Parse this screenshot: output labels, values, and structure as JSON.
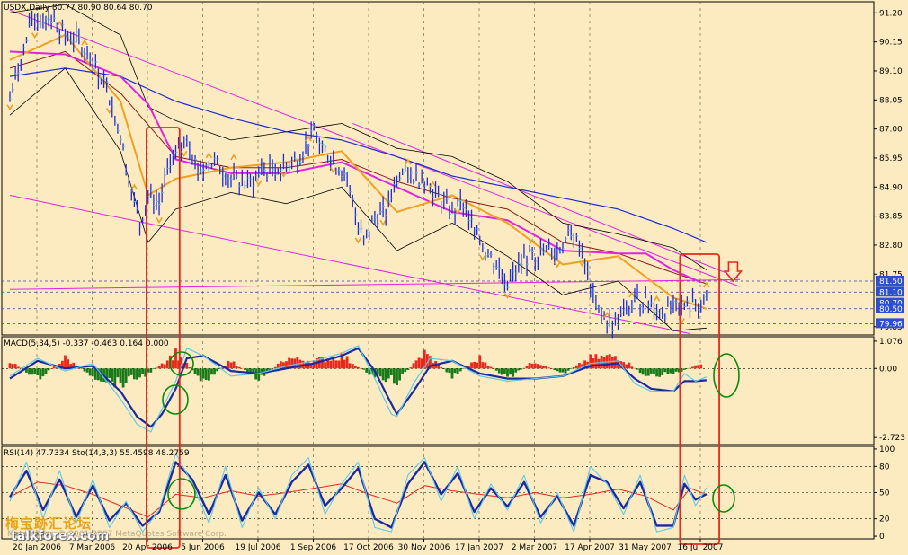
{
  "header": {
    "main": "USDX,Daily  80.77 80.90 80.64 80.70",
    "macd": "MACD(5,34,5) -0.337 -0.463 0.164 0.000",
    "rsi": "RSI(14) 47.7334  Sto(14,3,3) 55.4598 48.2759"
  },
  "watermark": {
    "site": "talkforex.com",
    "footer": "MetaTrader, © 2001-2007 MetaQuotes Software Corp.",
    "cn": "梅宝跡汇论坛"
  },
  "colors": {
    "background": "#FCEBC1",
    "axis": "#000000",
    "grid": "#7a6a4a",
    "rect_red": "#E8281C",
    "circle_green": "#0A8A0A",
    "price_line": "#1D2BD6",
    "macd_pos": "#E8281C",
    "macd_neg": "#1A7A1A",
    "ma_magenta": "#E024E0",
    "ma_orange": "#F0A020",
    "fractal": "#E8A12A"
  },
  "chart_data": [
    {
      "type": "line",
      "panel": "price",
      "symbol": "USDX",
      "timeframe": "Daily",
      "ohlc_last": {
        "open": 80.77,
        "high": 80.9,
        "low": 80.64,
        "close": 80.7
      },
      "y_ticks": [
        "91.20",
        "90.15",
        "89.10",
        "88.05",
        "87.00",
        "85.95",
        "84.90",
        "83.85",
        "82.80",
        "81.75",
        "79.85"
      ],
      "ylim": [
        79.55,
        91.6
      ],
      "price_labels": [
        {
          "text": "81.50",
          "value": 81.5
        },
        {
          "text": "81.10",
          "value": 81.1
        },
        {
          "text": "80.70",
          "value": 80.7
        },
        {
          "text": "80.50",
          "value": 80.5
        },
        {
          "text": "79.96",
          "value": 79.96
        }
      ],
      "x_ticks": [
        "20 Jan 2006",
        "7 Mar 2006",
        "20 Apr 2006",
        "5 Jun 2006",
        "19 Jul 2006",
        "1 Sep 2006",
        "17 Oct 2006",
        "30 Nov 2006",
        "17 Jan 2007",
        "2 Mar 2007",
        "17 Apr 2007",
        "31 May 2007",
        "16 Jul 2007"
      ],
      "x_tick_index": [
        0,
        1,
        2,
        3,
        4,
        5,
        6,
        7,
        8,
        9,
        10,
        11,
        12
      ],
      "close_anchors": {
        "x": [
          0,
          0.4,
          0.7,
          1.0,
          1.25,
          1.5,
          1.75,
          2.0,
          2.15,
          2.35,
          2.5,
          2.7,
          2.9,
          3.0,
          3.2,
          3.4,
          3.7,
          4.0,
          4.3,
          4.6,
          4.9,
          5.2,
          5.5,
          5.8,
          6.0,
          6.2,
          6.4,
          6.6,
          6.8,
          7.0,
          7.1,
          7.3,
          7.5,
          7.8,
          8.0,
          8.2,
          8.4,
          8.6,
          8.8,
          9.0,
          9.3,
          9.6,
          9.9,
          10.1,
          10.3,
          10.6,
          10.9,
          11.1,
          11.35,
          11.6,
          11.8,
          12.0,
          12.15,
          12.35,
          12.45,
          12.6
        ],
        "y": [
          88.1,
          90.9,
          91.1,
          90.4,
          90.2,
          89.4,
          88.5,
          86.7,
          85.2,
          83.6,
          84.6,
          84.3,
          85.9,
          86.0,
          86.7,
          85.5,
          85.8,
          85.2,
          85.0,
          85.5,
          85.6,
          85.9,
          86.9,
          85.9,
          85.5,
          84.3,
          82.9,
          83.8,
          84.0,
          85.1,
          85.4,
          85.3,
          85.2,
          84.4,
          84.0,
          84.3,
          83.3,
          82.6,
          82.1,
          81.4,
          82.3,
          82.5,
          82.6,
          83.1,
          82.9,
          80.5,
          79.9,
          80.3,
          80.8,
          80.7,
          80.4,
          80.5,
          80.55,
          80.6,
          80.65,
          80.7
        ]
      },
      "overlays": {
        "ma_magenta": {
          "x": [
            0,
            1,
            2,
            2.5,
            3,
            4,
            5,
            6,
            7,
            8,
            9,
            10,
            11,
            11.5,
            12,
            12.5
          ],
          "y": [
            89.8,
            89.7,
            88.9,
            87.9,
            85.9,
            85.4,
            85.4,
            85.8,
            84.9,
            84.0,
            83.7,
            82.6,
            82.5,
            82.5,
            81.9,
            81.45
          ]
        },
        "ma_orange": {
          "x": [
            0,
            1,
            2,
            2.5,
            3,
            4,
            5,
            6,
            7,
            8,
            9,
            10,
            11,
            12,
            12.6
          ],
          "y": [
            89.5,
            90.4,
            88.0,
            84.6,
            85.2,
            85.6,
            85.8,
            86.2,
            84.0,
            84.6,
            83.6,
            82.1,
            82.4,
            80.9,
            80.5
          ]
        },
        "ma_blue": {
          "x": [
            0,
            1,
            2,
            3,
            4,
            5,
            6,
            7,
            8,
            9,
            10,
            11,
            12,
            12.6
          ],
          "y": [
            88.9,
            89.2,
            88.9,
            88.0,
            87.4,
            86.9,
            86.6,
            86.0,
            85.3,
            84.9,
            84.5,
            84.1,
            83.4,
            82.9
          ]
        },
        "ma_darkred": {
          "x": [
            0,
            1,
            2,
            3,
            4,
            5,
            6,
            7,
            8,
            9,
            10,
            11,
            12,
            12.6
          ],
          "y": [
            89.2,
            89.8,
            88.3,
            86.0,
            85.6,
            85.6,
            85.9,
            85.1,
            84.5,
            84.1,
            82.9,
            82.5,
            81.8,
            81.4
          ]
        },
        "bb_upper": {
          "x": [
            0,
            1,
            2,
            2.5,
            3,
            4,
            5,
            6,
            7,
            8,
            9,
            10,
            11,
            12,
            12.6
          ],
          "y": [
            91.2,
            91.5,
            90.4,
            87.8,
            87.3,
            86.6,
            86.9,
            87.2,
            86.3,
            86.0,
            85.1,
            83.6,
            83.2,
            82.7,
            81.9
          ]
        },
        "bb_lower": {
          "x": [
            0,
            1,
            2,
            2.5,
            3,
            4,
            5,
            6,
            7,
            8,
            9,
            10,
            11,
            12,
            12.6
          ],
          "y": [
            87.5,
            89.2,
            86.2,
            82.9,
            84.1,
            84.7,
            84.3,
            84.9,
            82.6,
            83.6,
            82.4,
            81.0,
            81.5,
            79.7,
            79.8
          ]
        }
      },
      "trendlines": [
        {
          "from": {
            "x": 0.0,
            "y": 91.3
          },
          "to": {
            "x": 13.2,
            "y": 81.3
          }
        },
        {
          "from": {
            "x": 6.2,
            "y": 87.2
          },
          "to": {
            "x": 13.2,
            "y": 81.6
          }
        },
        {
          "from": {
            "x": 0.0,
            "y": 84.6
          },
          "to": {
            "x": 12.3,
            "y": 79.6
          }
        },
        {
          "from": {
            "x": 0.0,
            "y": 81.2
          },
          "to": {
            "x": 13.2,
            "y": 81.55
          }
        }
      ],
      "levels": [
        81.5,
        81.1,
        80.5,
        79.96
      ],
      "highlight_boxes": [
        {
          "x0": 2.47,
          "x1": 3.07,
          "panes": "all"
        },
        {
          "x0": 12.12,
          "x1": 12.83,
          "panes": "all"
        }
      ],
      "arrow": {
        "direction": "down",
        "x": 13.08,
        "y": 81.6
      }
    },
    {
      "type": "bar",
      "panel": "macd",
      "title": "MACD(5,34,5) -0.337 -0.463 0.164 0.000",
      "y_ticks": [
        "1.076",
        "0.00",
        "-2.723"
      ],
      "ylim": [
        -3.0,
        1.25
      ],
      "histogram": {
        "x": [
          0,
          0.5,
          1,
          1.5,
          2,
          2.5,
          3,
          3.5,
          4,
          4.5,
          5,
          5.5,
          6,
          6.5,
          7,
          7.5,
          8,
          8.5,
          9,
          9.5,
          10,
          10.5,
          11,
          11.5,
          12,
          12.5
        ],
        "y": [
          0.3,
          -0.4,
          0.4,
          -0.3,
          -0.6,
          -0.2,
          0.6,
          -0.5,
          0.3,
          -0.4,
          0.4,
          0.3,
          0.5,
          -0.2,
          -0.5,
          0.6,
          -0.3,
          0.4,
          -0.4,
          0.3,
          -0.2,
          0.4,
          0.5,
          -0.3,
          -0.2,
          0.164
        ]
      },
      "macd_line": {
        "x": [
          0,
          0.5,
          1,
          1.5,
          2,
          2.3,
          2.55,
          2.75,
          3,
          3.2,
          3.5,
          4,
          4.5,
          5,
          5.5,
          6,
          6.3,
          6.6,
          6.9,
          7.0,
          7.3,
          7.6,
          8,
          8.5,
          9,
          9.5,
          10,
          10.5,
          11,
          11.3,
          11.6,
          12,
          12.2,
          12.4,
          12.6
        ],
        "y": [
          -0.3,
          0.4,
          -0.1,
          0.2,
          -1.2,
          -2.2,
          -2.5,
          -1.6,
          -0.5,
          0.8,
          0.5,
          -0.3,
          -0.2,
          0.1,
          0.3,
          0.6,
          0.9,
          -0.4,
          -1.8,
          -1.9,
          -0.6,
          0.4,
          0.3,
          -0.3,
          -0.5,
          -0.4,
          -0.3,
          0.2,
          0.3,
          -0.6,
          -0.9,
          -0.9,
          -0.2,
          -0.5,
          -0.337
        ]
      },
      "signal_line": {
        "x": [
          0,
          0.5,
          1,
          1.5,
          2,
          2.3,
          2.55,
          2.75,
          3,
          3.2,
          3.5,
          4,
          4.5,
          5,
          5.5,
          6,
          6.3,
          6.6,
          6.9,
          7.0,
          7.3,
          7.6,
          8,
          8.5,
          9,
          9.5,
          10,
          10.5,
          11,
          11.3,
          11.6,
          12,
          12.2,
          12.4,
          12.6
        ],
        "y": [
          -0.4,
          0.3,
          0.0,
          0.1,
          -0.9,
          -1.9,
          -2.3,
          -1.8,
          -0.8,
          0.4,
          0.5,
          -0.1,
          -0.2,
          0.0,
          0.2,
          0.5,
          0.8,
          -0.1,
          -1.4,
          -1.8,
          -0.9,
          0.1,
          0.3,
          -0.2,
          -0.4,
          -0.4,
          -0.3,
          0.1,
          0.2,
          -0.4,
          -0.8,
          -0.9,
          -0.5,
          -0.5,
          -0.463
        ]
      }
    },
    {
      "type": "line",
      "panel": "rsi_stochastic",
      "title": "RSI(14) 47.7334  Sto(14,3,3) 55.4598 48.2759",
      "y_ticks": [
        "100",
        "80",
        "50",
        "20",
        "0"
      ],
      "ylim": [
        -3,
        103
      ],
      "rsi": {
        "x": [
          0,
          0.5,
          1,
          1.5,
          2,
          2.5,
          3,
          3.5,
          4,
          4.5,
          5,
          5.5,
          6,
          6.5,
          7,
          7.5,
          8,
          8.5,
          9,
          9.5,
          10,
          10.5,
          11,
          11.5,
          12,
          12.3,
          12.6
        ],
        "y": [
          45,
          62,
          58,
          48,
          35,
          22,
          48,
          44,
          52,
          46,
          50,
          55,
          60,
          48,
          38,
          58,
          52,
          48,
          44,
          50,
          44,
          48,
          54,
          46,
          30,
          55,
          47.7
        ]
      },
      "sto_main": {
        "x": [
          0,
          0.3,
          0.6,
          0.9,
          1.2,
          1.5,
          1.8,
          2.1,
          2.4,
          2.7,
          3.0,
          3.3,
          3.6,
          3.9,
          4.2,
          4.5,
          4.8,
          5.1,
          5.4,
          5.7,
          6.0,
          6.3,
          6.6,
          6.9,
          7.2,
          7.5,
          7.8,
          8.1,
          8.4,
          8.7,
          9.0,
          9.3,
          9.6,
          9.9,
          10.2,
          10.5,
          10.8,
          11.1,
          11.4,
          11.7,
          12.0,
          12.2,
          12.4,
          12.6
        ],
        "y": [
          40,
          85,
          20,
          75,
          15,
          65,
          10,
          40,
          5,
          30,
          95,
          60,
          15,
          80,
          10,
          55,
          20,
          70,
          90,
          25,
          60,
          85,
          10,
          5,
          70,
          90,
          40,
          80,
          20,
          60,
          30,
          70,
          15,
          50,
          5,
          80,
          60,
          25,
          70,
          5,
          10,
          70,
          35,
          55.5
        ]
      },
      "sto_signal": {
        "x": [
          0,
          0.3,
          0.6,
          0.9,
          1.2,
          1.5,
          1.8,
          2.1,
          2.4,
          2.7,
          3.0,
          3.3,
          3.6,
          3.9,
          4.2,
          4.5,
          4.8,
          5.1,
          5.4,
          5.7,
          6.0,
          6.3,
          6.6,
          6.9,
          7.2,
          7.5,
          7.8,
          8.1,
          8.4,
          8.7,
          9.0,
          9.3,
          9.6,
          9.9,
          10.2,
          10.5,
          10.8,
          11.1,
          11.4,
          11.7,
          12.0,
          12.2,
          12.4,
          12.6
        ],
        "y": [
          45,
          75,
          30,
          65,
          22,
          58,
          18,
          38,
          12,
          28,
          85,
          65,
          25,
          70,
          18,
          50,
          25,
          62,
          82,
          35,
          55,
          78,
          20,
          10,
          60,
          85,
          48,
          72,
          28,
          55,
          34,
          62,
          22,
          46,
          12,
          70,
          62,
          32,
          62,
          12,
          12,
          60,
          42,
          48.3
        ]
      }
    }
  ]
}
